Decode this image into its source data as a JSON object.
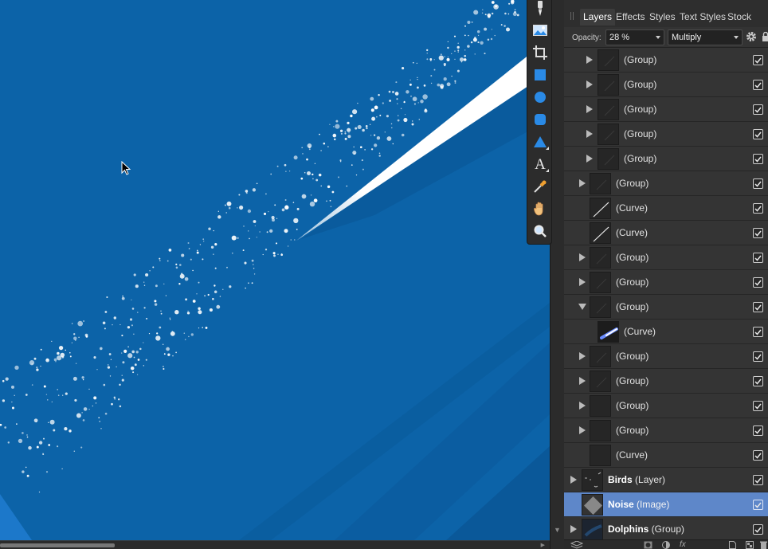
{
  "panel": {
    "tabs": [
      {
        "label": "Layers",
        "active": true
      },
      {
        "label": "Effects",
        "active": false
      },
      {
        "label": "Styles",
        "active": false
      },
      {
        "label": "Text Styles",
        "active": false
      },
      {
        "label": "Stock",
        "active": false
      }
    ],
    "opacity_label": "Opacity:",
    "opacity_value": "28 %",
    "blend_mode": "Multiply",
    "bottom_fx_label": "fx"
  },
  "layers": [
    {
      "name": "",
      "type": "(Group)",
      "level": 2,
      "expander": "collapsed",
      "visible": true,
      "selected": false,
      "thumb": "dark"
    },
    {
      "name": "",
      "type": "(Group)",
      "level": 2,
      "expander": "collapsed",
      "visible": true,
      "selected": false,
      "thumb": "dark"
    },
    {
      "name": "",
      "type": "(Group)",
      "level": 2,
      "expander": "collapsed",
      "visible": true,
      "selected": false,
      "thumb": "dark"
    },
    {
      "name": "",
      "type": "(Group)",
      "level": 2,
      "expander": "collapsed",
      "visible": true,
      "selected": false,
      "thumb": "dark"
    },
    {
      "name": "",
      "type": "(Group)",
      "level": 2,
      "expander": "collapsed",
      "visible": true,
      "selected": false,
      "thumb": "dark"
    },
    {
      "name": "",
      "type": "(Group)",
      "level": 1,
      "expander": "collapsed",
      "visible": true,
      "selected": false,
      "thumb": "dark"
    },
    {
      "name": "",
      "type": "(Curve)",
      "level": 1,
      "expander": "none",
      "visible": true,
      "selected": false,
      "thumb": "curve"
    },
    {
      "name": "",
      "type": "(Curve)",
      "level": 1,
      "expander": "none",
      "visible": true,
      "selected": false,
      "thumb": "curve"
    },
    {
      "name": "",
      "type": "(Group)",
      "level": 1,
      "expander": "collapsed",
      "visible": true,
      "selected": false,
      "thumb": "dark"
    },
    {
      "name": "",
      "type": "(Group)",
      "level": 1,
      "expander": "collapsed",
      "visible": true,
      "selected": false,
      "thumb": "dark"
    },
    {
      "name": "",
      "type": "(Group)",
      "level": 1,
      "expander": "expanded",
      "visible": true,
      "selected": false,
      "thumb": "dark"
    },
    {
      "name": "",
      "type": "(Curve)",
      "level": 2,
      "expander": "none",
      "visible": true,
      "selected": false,
      "thumb": "blue-curve"
    },
    {
      "name": "",
      "type": "(Group)",
      "level": 1,
      "expander": "collapsed",
      "visible": true,
      "selected": false,
      "thumb": "dark"
    },
    {
      "name": "",
      "type": "(Group)",
      "level": 1,
      "expander": "collapsed",
      "visible": true,
      "selected": false,
      "thumb": "dark"
    },
    {
      "name": "",
      "type": "(Group)",
      "level": 1,
      "expander": "collapsed",
      "visible": true,
      "selected": false,
      "thumb": "empty"
    },
    {
      "name": "",
      "type": "(Group)",
      "level": 1,
      "expander": "collapsed",
      "visible": true,
      "selected": false,
      "thumb": "empty"
    },
    {
      "name": "",
      "type": "(Curve)",
      "level": 1,
      "expander": "none",
      "visible": true,
      "selected": false,
      "thumb": "empty"
    },
    {
      "name": "Birds",
      "type": "(Layer)",
      "level": 0,
      "expander": "collapsed",
      "visible": true,
      "selected": false,
      "thumb": "birds"
    },
    {
      "name": "Noise",
      "type": "(Image)",
      "level": 0,
      "expander": "none",
      "visible": true,
      "selected": true,
      "thumb": "noise"
    },
    {
      "name": "Dolphins",
      "type": "(Group)",
      "level": 0,
      "expander": "collapsed",
      "visible": true,
      "selected": false,
      "thumb": "dolphins"
    }
  ],
  "tools": [
    "brush-tool-icon",
    "place-image-tool-icon",
    "crop-tool-icon",
    "rectangle-tool-icon",
    "ellipse-tool-icon",
    "rounded-rectangle-tool-icon",
    "triangle-tool-icon",
    "text-tool-icon",
    "color-picker-tool-icon",
    "hand-tool-icon",
    "zoom-tool-icon"
  ],
  "colors": {
    "canvas_blue": "#0c63a8",
    "canvas_dark_blue": "#0a5593",
    "selected_row": "#5e87c9",
    "panel_bg": "#2e2e2e",
    "tool_blue": "#2a8ae6"
  }
}
